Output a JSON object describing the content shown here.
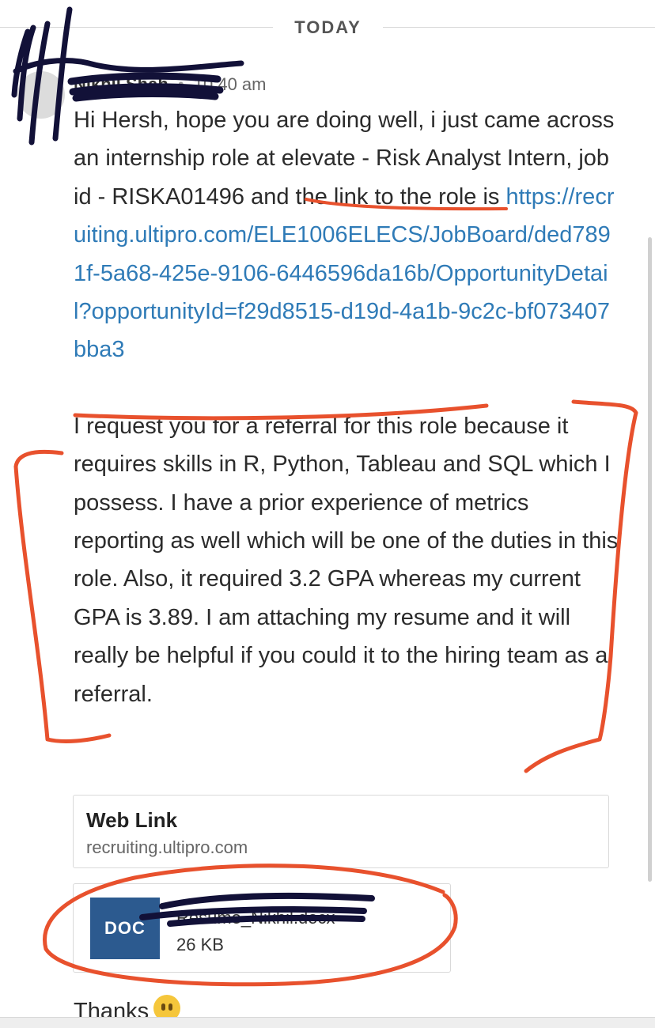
{
  "day_separator": "TODAY",
  "message": {
    "sender_name": "Nikhil Shah",
    "time": "10:40 am",
    "paragraph1_text": "Hi Hersh, hope you are doing well, i just came across an internship role at elevate - Risk Analyst Intern, job id - RISKA01496 and the link to the role is ",
    "paragraph1_link": "https://recruiting.ultipro.com/ELE1006ELECS/JobBoard/ded7891f-5a68-425e-9106-6446596da16b/OpportunityDetail?opportunityId=f29d8515-d19d-4a1b-9c2c-bf073407bba3",
    "paragraph2": "I request you for a referral for this role because it requires skills in R, Python, Tableau and SQL which I possess. I have  a prior experience of metrics reporting as well which will be one of the duties in this role. Also, it required 3.2 GPA whereas my current GPA is 3.89. I am attaching my resume and it will really be helpful if you could it  to the hiring team  as a referral.",
    "thanks": "Thanks"
  },
  "web_link_card": {
    "title": "Web Link",
    "host": "recruiting.ultipro.com"
  },
  "attachment": {
    "type_label": "DOC",
    "file_name": "Resume_Nikhil.docx",
    "file_size": "26 KB",
    "icon_color": "#2c5a8f"
  },
  "colors": {
    "link": "#2f7bb7",
    "annotation": "#e8512d",
    "redaction": "#121138"
  },
  "icons": {
    "avatar": "avatar-icon",
    "emoji": "slightly-smiling-emoji-icon"
  }
}
